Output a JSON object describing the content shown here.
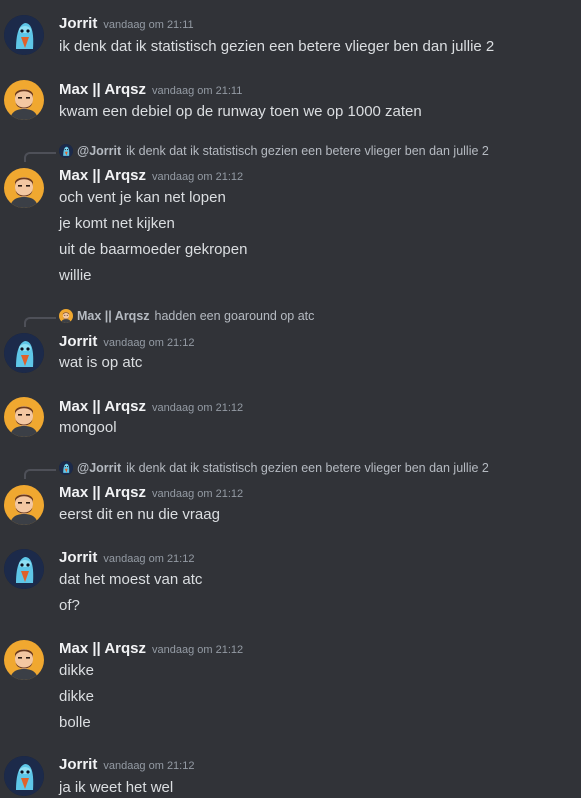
{
  "timestamps": {
    "t2111": "vandaag om 21:11",
    "t2112": "vandaag om 21:12"
  },
  "users": {
    "jorrit": "Jorrit",
    "max": "Max || Arqsz"
  },
  "messages": [
    {
      "author": "Jorrit",
      "time": "vandaag om 21:11",
      "lines": [
        "ik denk dat ik statistisch gezien een betere vlieger ben dan jullie 2"
      ]
    },
    {
      "author": "Max || Arqsz",
      "time": "vandaag om 21:11",
      "lines": [
        "kwam een debiel op de runway toen we op 1000 zaten"
      ]
    },
    {
      "reply_to": "@Jorrit",
      "reply_text": "ik denk dat ik statistisch gezien een betere vlieger ben dan jullie 2",
      "author": "Max || Arqsz",
      "time": "vandaag om 21:12",
      "lines": [
        "och vent je kan net lopen",
        "je komt net kijken",
        "uit de baarmoeder gekropen",
        "willie"
      ]
    },
    {
      "reply_to": "Max || Arqsz",
      "reply_text": "hadden een goaround op atc",
      "author": "Jorrit",
      "time": "vandaag om 21:12",
      "lines": [
        "wat is op atc"
      ]
    },
    {
      "author": "Max || Arqsz",
      "time": "vandaag om 21:12",
      "lines": [
        "mongool"
      ]
    },
    {
      "reply_to": "@Jorrit",
      "reply_text": "ik denk dat ik statistisch gezien een betere vlieger ben dan jullie 2",
      "author": "Max || Arqsz",
      "time": "vandaag om 21:12",
      "lines": [
        "eerst dit en nu die vraag"
      ]
    },
    {
      "author": "Jorrit",
      "time": "vandaag om 21:12",
      "lines": [
        "dat het moest van atc",
        "of?"
      ]
    },
    {
      "author": "Max || Arqsz",
      "time": "vandaag om 21:12",
      "lines": [
        "dikke",
        "dikke",
        "bolle"
      ]
    },
    {
      "author": "Jorrit",
      "time": "vandaag om 21:12",
      "lines": [
        "ja ik weet het wel"
      ]
    }
  ],
  "avatar_icons": {
    "jorrit": "jorrit-avatar-icon",
    "max": "max-avatar-icon"
  },
  "colors": {
    "background": "#313338",
    "name": "#f2f3f5",
    "text": "#dbdee1",
    "timestamp": "#949ba4",
    "max_avatar_bg": "#f0a830"
  }
}
